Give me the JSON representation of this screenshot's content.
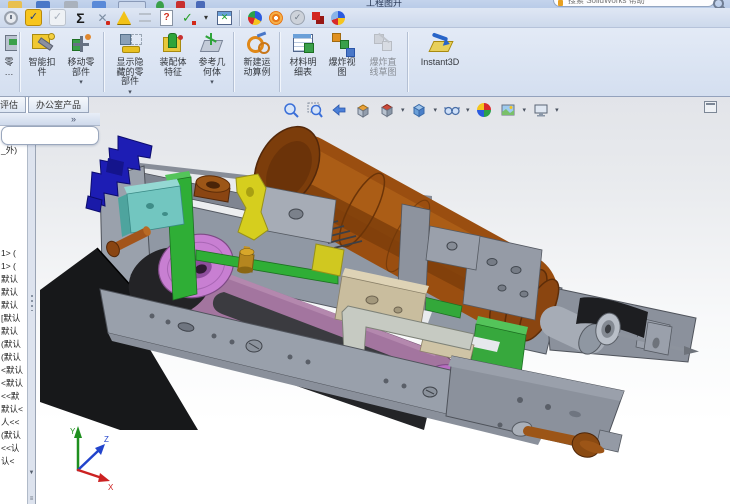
{
  "window": {
    "title_fragment": "工程图升",
    "search_placeholder": "搜索 SolidWorks 帮助"
  },
  "quick_access": {
    "icons": [
      "open-icon",
      "save-icon",
      "print-icon",
      "undo-icon",
      "select-tool-icon",
      "status-green-icon",
      "stop-red-icon",
      "options-blue-icon"
    ]
  },
  "evaluate_toolbar": {
    "icons": [
      {
        "name": "design-history-icon",
        "glyph": ""
      },
      {
        "name": "interference-detection-icon",
        "glyph": "✓"
      },
      {
        "name": "clearance-verification-icon",
        "glyph": "✓"
      },
      {
        "name": "equations-icon",
        "glyph": "Σ"
      },
      {
        "name": "measure-icon",
        "glyph": "✕"
      },
      {
        "name": "hole-alignment-icon",
        "glyph": ""
      },
      {
        "name": "align-icon",
        "glyph": ""
      },
      {
        "name": "performance-evaluation-icon",
        "glyph": "?"
      },
      {
        "name": "check-document-icon",
        "glyph": "✓"
      },
      {
        "name": "dropdown-icon",
        "glyph": "▾"
      },
      {
        "name": "statistics-table-icon",
        "glyph": "✕"
      },
      {
        "name": "edrawings-icon",
        "glyph": ""
      },
      {
        "name": "photoview-icon",
        "glyph": ""
      },
      {
        "name": "approve-icon",
        "glyph": "✓"
      },
      {
        "name": "compare-icon",
        "glyph": ""
      },
      {
        "name": "simulation-sphere-icon",
        "glyph": ""
      }
    ]
  },
  "command_manager": {
    "dropdown_arrow": "▾",
    "buttons": [
      {
        "label": "零\n…",
        "name": "insert-components-button"
      },
      {
        "label": "智能扣\n件",
        "name": "smart-fasteners-button"
      },
      {
        "label": "移动零\n部件",
        "name": "move-component-button",
        "dropdown": true
      },
      {
        "label": "显示隐\n藏的零\n部件",
        "name": "show-hidden-components-button",
        "dropdown": true
      },
      {
        "label": "装配体\n特征",
        "name": "assembly-features-button"
      },
      {
        "label": "参考几\n何体",
        "name": "reference-geometry-button",
        "dropdown": true
      },
      {
        "label": "新建运\n动算例",
        "name": "new-motion-study-button"
      },
      {
        "label": "材料明\n细表",
        "name": "bill-of-materials-button"
      },
      {
        "label": "爆炸视\n图",
        "name": "exploded-view-button"
      },
      {
        "label": "爆炸直\n线草图",
        "name": "explode-line-sketch-button",
        "disabled": true
      },
      {
        "label": "Instant3D",
        "name": "instant3d-button"
      }
    ]
  },
  "tabs": {
    "items": [
      "评估",
      "办公室产品"
    ]
  },
  "feature_panel": {
    "chevron": "»",
    "scroll_up": "▲",
    "scroll_down": "▼",
    "resize": "≡",
    "items": [
      "_外)",
      "1> (",
      "1> (",
      "默认",
      "默认",
      "默认",
      "[默认",
      "默认",
      "(默认",
      "(默认",
      "<默认",
      "<默认",
      "<<默",
      "默认<",
      "人<<",
      "(默认",
      "<<认",
      "认<"
    ]
  },
  "heads_up": {
    "dropdown_arrow": "▾",
    "icons": [
      "zoom-fit-icon",
      "zoom-area-icon",
      "previous-view-icon",
      "section-view-icon",
      "view-orientation-icon",
      "display-style-icon",
      "hide-show-items-icon",
      "edit-appearance-icon",
      "apply-scene-icon",
      "view-settings-icon"
    ]
  },
  "viewport": {
    "triad": {
      "x": "X",
      "y": "Y",
      "z": "Z"
    }
  },
  "model_colors": {
    "frame_gray": "#949aa6",
    "motor_brown": "#9a4e10",
    "pulley_magenta": "#c87fd2",
    "belt_mauve": "#a3759f",
    "plate_black": "#17181a",
    "bracket_blue": "#1d1db4",
    "block_teal": "#72c6c0",
    "guide_green": "#2fae36",
    "part_yellow": "#d6ce1e",
    "bolt_brown": "#9c5517",
    "fitting_brass": "#b5861f",
    "block_tan": "#c9bd9e"
  }
}
